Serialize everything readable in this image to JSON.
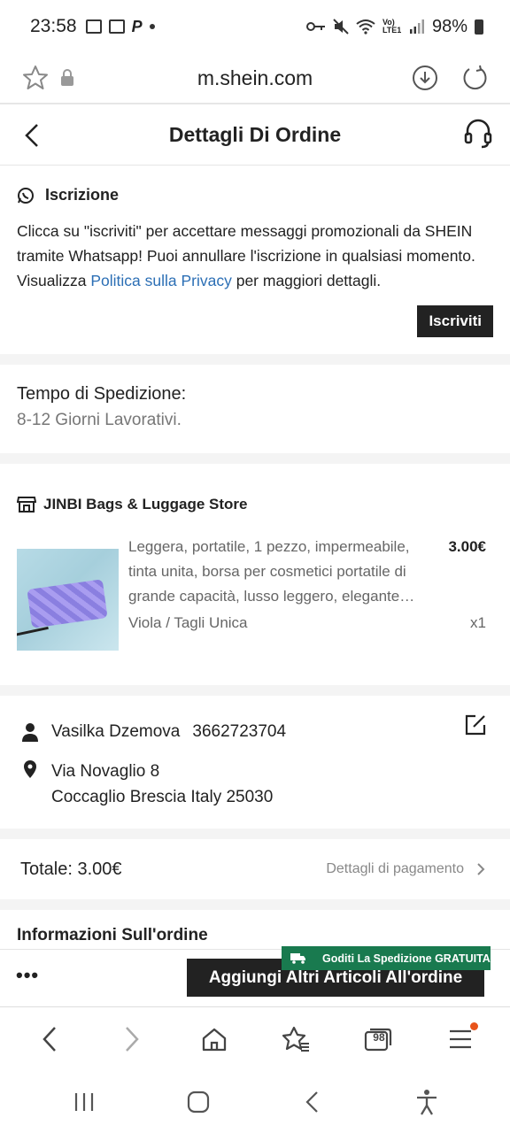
{
  "status_bar": {
    "time": "23:58",
    "battery": "98%",
    "network": "Vo) LTE1"
  },
  "browser": {
    "url": "m.shein.com",
    "tab_count": "98"
  },
  "header": {
    "title": "Dettagli Di Ordine"
  },
  "subscribe": {
    "title": "Iscrizione",
    "message_before": "Clicca su \"iscriviti\" per accettare messaggi promozionali da SHEIN tramite Whatsapp! Puoi annullare l'iscrizione in qualsiasi momento. Visualizza ",
    "link": "Politica sulla Privacy",
    "message_after": " per maggiori dettagli.",
    "button": "Iscriviti"
  },
  "shipping": {
    "label": "Tempo di Spedizione:",
    "value": "8-12 Giorni Lavorativi."
  },
  "store": {
    "name": "JINBI Bags & Luggage Store",
    "product": {
      "description": "Leggera, portatile, 1 pezzo, impermeabile, tinta unita, borsa per cosmetici portatile di grande capacità, lusso leggero, elegante…",
      "price": "3.00€",
      "variant": "Viola / Tagli Unica",
      "quantity": "x1"
    }
  },
  "address": {
    "name": "Vasilka Dzemova",
    "phone": "3662723704",
    "line1": "Via Novaglio 8",
    "line2": "Coccaglio Brescia Italy 25030"
  },
  "total": {
    "label": "Totale: 3.00€",
    "payment_link": "Dettagli di pagamento"
  },
  "info": {
    "title": "Informazioni Sull'ordine"
  },
  "bottom_action": {
    "more": "•••",
    "free_shipping_badge": "Goditi La Spedizione GRATUITA",
    "add_button": "Aggiungi Altri Articoli All'ordine"
  },
  "colors": {
    "link": "#2c6fb5",
    "badge_green": "#197a4f",
    "button_dark": "#222222",
    "notification_dot": "#e8531a"
  }
}
